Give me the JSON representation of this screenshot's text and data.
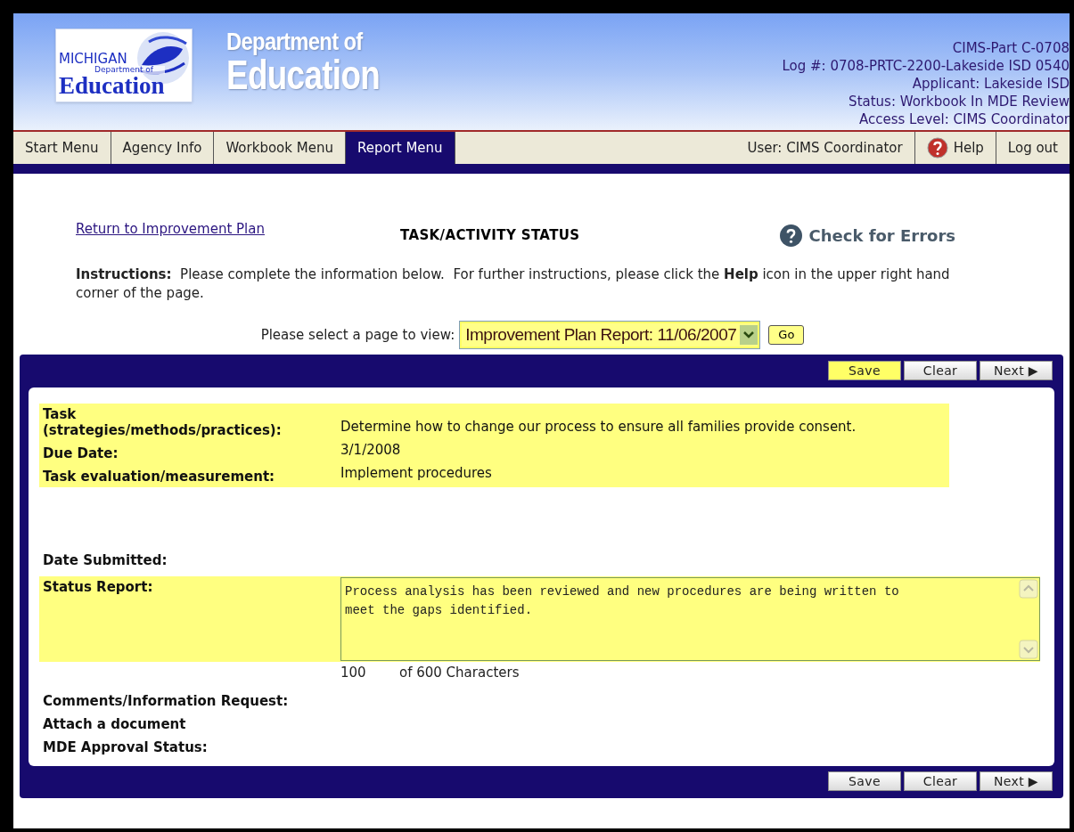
{
  "header": {
    "logo": {
      "line1": "MICHIGAN",
      "line2": "Department of",
      "line3": "Education"
    },
    "title_line1": "Department of",
    "title_line2": "Education",
    "info_lines": [
      "CIMS-Part C-0708",
      "Log #: 0708-PRTC-2200-Lakeside ISD 0540",
      "Applicant: Lakeside ISD",
      "Status: Workbook In MDE Review",
      "Access Level: CIMS Coordinator"
    ]
  },
  "nav": {
    "tabs": [
      {
        "label": "Start Menu",
        "selected": false
      },
      {
        "label": "Agency Info",
        "selected": false
      },
      {
        "label": "Workbook Menu",
        "selected": false
      },
      {
        "label": "Report Menu",
        "selected": true
      }
    ],
    "user": "User: CIMS Coordinator",
    "help": "Help",
    "logout": "Log out"
  },
  "page": {
    "return_link": "Return to Improvement Plan",
    "title": "TASK/ACTIVITY STATUS",
    "check_errors": "Check for Errors",
    "instructions": "**Instructions:**  Please complete the information below.  For further instructions, please click the **Help** icon in the upper right hand corner of the page.",
    "page_select": {
      "label": "Please select a page to view:",
      "value": "Improvement Plan Report: 11/06/2007",
      "go": "Go"
    }
  },
  "toolbar_top": [
    {
      "label": "Save",
      "highlighted": true
    },
    {
      "label": "Clear",
      "highlighted": false
    },
    {
      "label": "Next ▶",
      "highlighted": false
    }
  ],
  "task_fields": {
    "highlighted": true,
    "rows": [
      {
        "label": "Task (strategies/methods/practices):",
        "value": "Determine how to change our process to ensure all families provide consent."
      },
      {
        "label": "Due Date:",
        "value": "3/1/2008"
      },
      {
        "label": "Task evaluation/measurement:",
        "value": "Implement procedures"
      }
    ]
  },
  "date_submitted": {
    "label": "Date Submitted:"
  },
  "status_report": {
    "label": "Status Report:",
    "value": "Process analysis has been reviewed and new procedures are being written to meet the gaps identified.",
    "highlighted": true,
    "count": "100",
    "count_suffix": "of 600 Characters"
  },
  "more_fields": [
    "Comments/Information Request:",
    "Attach a document",
    "MDE Approval Status:"
  ],
  "toolbar_bottom": [
    {
      "label": "Save",
      "highlighted": false
    },
    {
      "label": "Clear",
      "highlighted": false
    },
    {
      "label": "Next ▶",
      "highlighted": false
    }
  ]
}
